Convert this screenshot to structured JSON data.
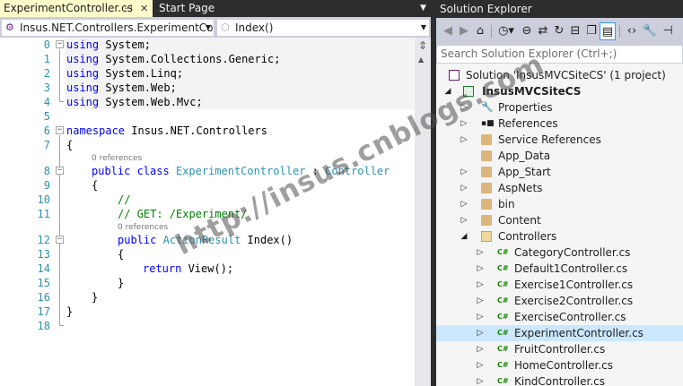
{
  "editor": {
    "tabs": [
      {
        "label": "ExperimentController.cs",
        "active": true
      },
      {
        "label": "Start Page",
        "active": false
      }
    ],
    "nav_left": "Insus.NET.Controllers.ExperimentCont",
    "nav_right": "Index()",
    "line_numbers": [
      "0",
      "1",
      "2",
      "3",
      "4",
      "5",
      "6",
      "7",
      "8",
      "9",
      "10",
      "11",
      "12",
      "13",
      "14",
      "15",
      "16",
      "17",
      "18"
    ],
    "code": {
      "l0": [
        "using",
        " System;"
      ],
      "l1": [
        "using",
        " System.Collections.Generic;"
      ],
      "l2": [
        "using",
        " System.Linq;"
      ],
      "l3": [
        "using",
        " System.Web;"
      ],
      "l4": [
        "using",
        " System.Web.Mvc;"
      ],
      "l6a": "namespace",
      "l6b": " Insus.NET.Controllers",
      "l7": "{",
      "refs_class": "0 references",
      "l8a": "public class",
      "l8b": "ExperimentController",
      "l8c": " : ",
      "l8d": "Controller",
      "l9": "{",
      "l10": "//",
      "l11": "// GET: /Experiment/",
      "refs_method": "0 references",
      "l12a": "public",
      "l12b": "ActionResult",
      "l12c": " Index()",
      "l13": "{",
      "l14a": "return",
      "l14b": " View();",
      "l15": "}",
      "l16": "}",
      "l17": "}"
    }
  },
  "watermark": "http://insus.cnblogs.com",
  "solution_explorer": {
    "title": "Solution Explorer",
    "search_placeholder": "Search Solution Explorer (Ctrl+;)",
    "solution": "Solution 'InsusMVCSiteCS' (1 project)",
    "project": "InsusMVCSiteCS",
    "items": [
      {
        "label": "Properties",
        "icon": "wrench-icon"
      },
      {
        "label": "References",
        "icon": "references-icon"
      },
      {
        "label": "Service References",
        "icon": "folder-icon"
      },
      {
        "label": "App_Data",
        "icon": "folder-icon"
      },
      {
        "label": "App_Start",
        "icon": "folder-icon"
      },
      {
        "label": "AspNets",
        "icon": "folder-icon"
      },
      {
        "label": "bin",
        "icon": "folder-icon"
      },
      {
        "label": "Content",
        "icon": "folder-icon"
      },
      {
        "label": "Controllers",
        "icon": "folder-open-icon"
      }
    ],
    "controllers": [
      "CategoryController.cs",
      "Default1Controller.cs",
      "Exercise1Controller.cs",
      "Exercise2Controller.cs",
      "ExerciseController.cs",
      "ExperimentController.cs",
      "FruitController.cs",
      "HomeController.cs",
      "KindController.cs"
    ],
    "selected": "ExperimentController.cs",
    "cs_badge": "C#"
  },
  "colors": {
    "keyword": "#0000ff",
    "type": "#2b91af",
    "comment": "#008000",
    "chrome": "#2d2d30",
    "selection": "#cce8ff"
  }
}
